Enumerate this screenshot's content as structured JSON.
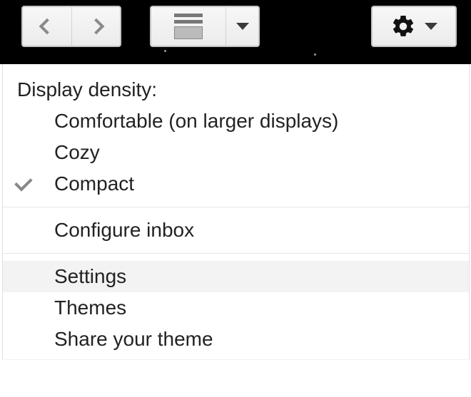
{
  "toolbar": {
    "back_button": "Back",
    "forward_button": "Forward",
    "split_button": "Toggle split pane",
    "settings_button": "Settings"
  },
  "menu": {
    "density_header": "Display density:",
    "density_options": {
      "comfortable": "Comfortable (on larger displays)",
      "cozy": "Cozy",
      "compact": "Compact"
    },
    "density_selected": "compact",
    "configure_inbox": "Configure inbox",
    "settings": "Settings",
    "themes": "Themes",
    "share_theme": "Share your theme",
    "hovered_item": "settings"
  }
}
